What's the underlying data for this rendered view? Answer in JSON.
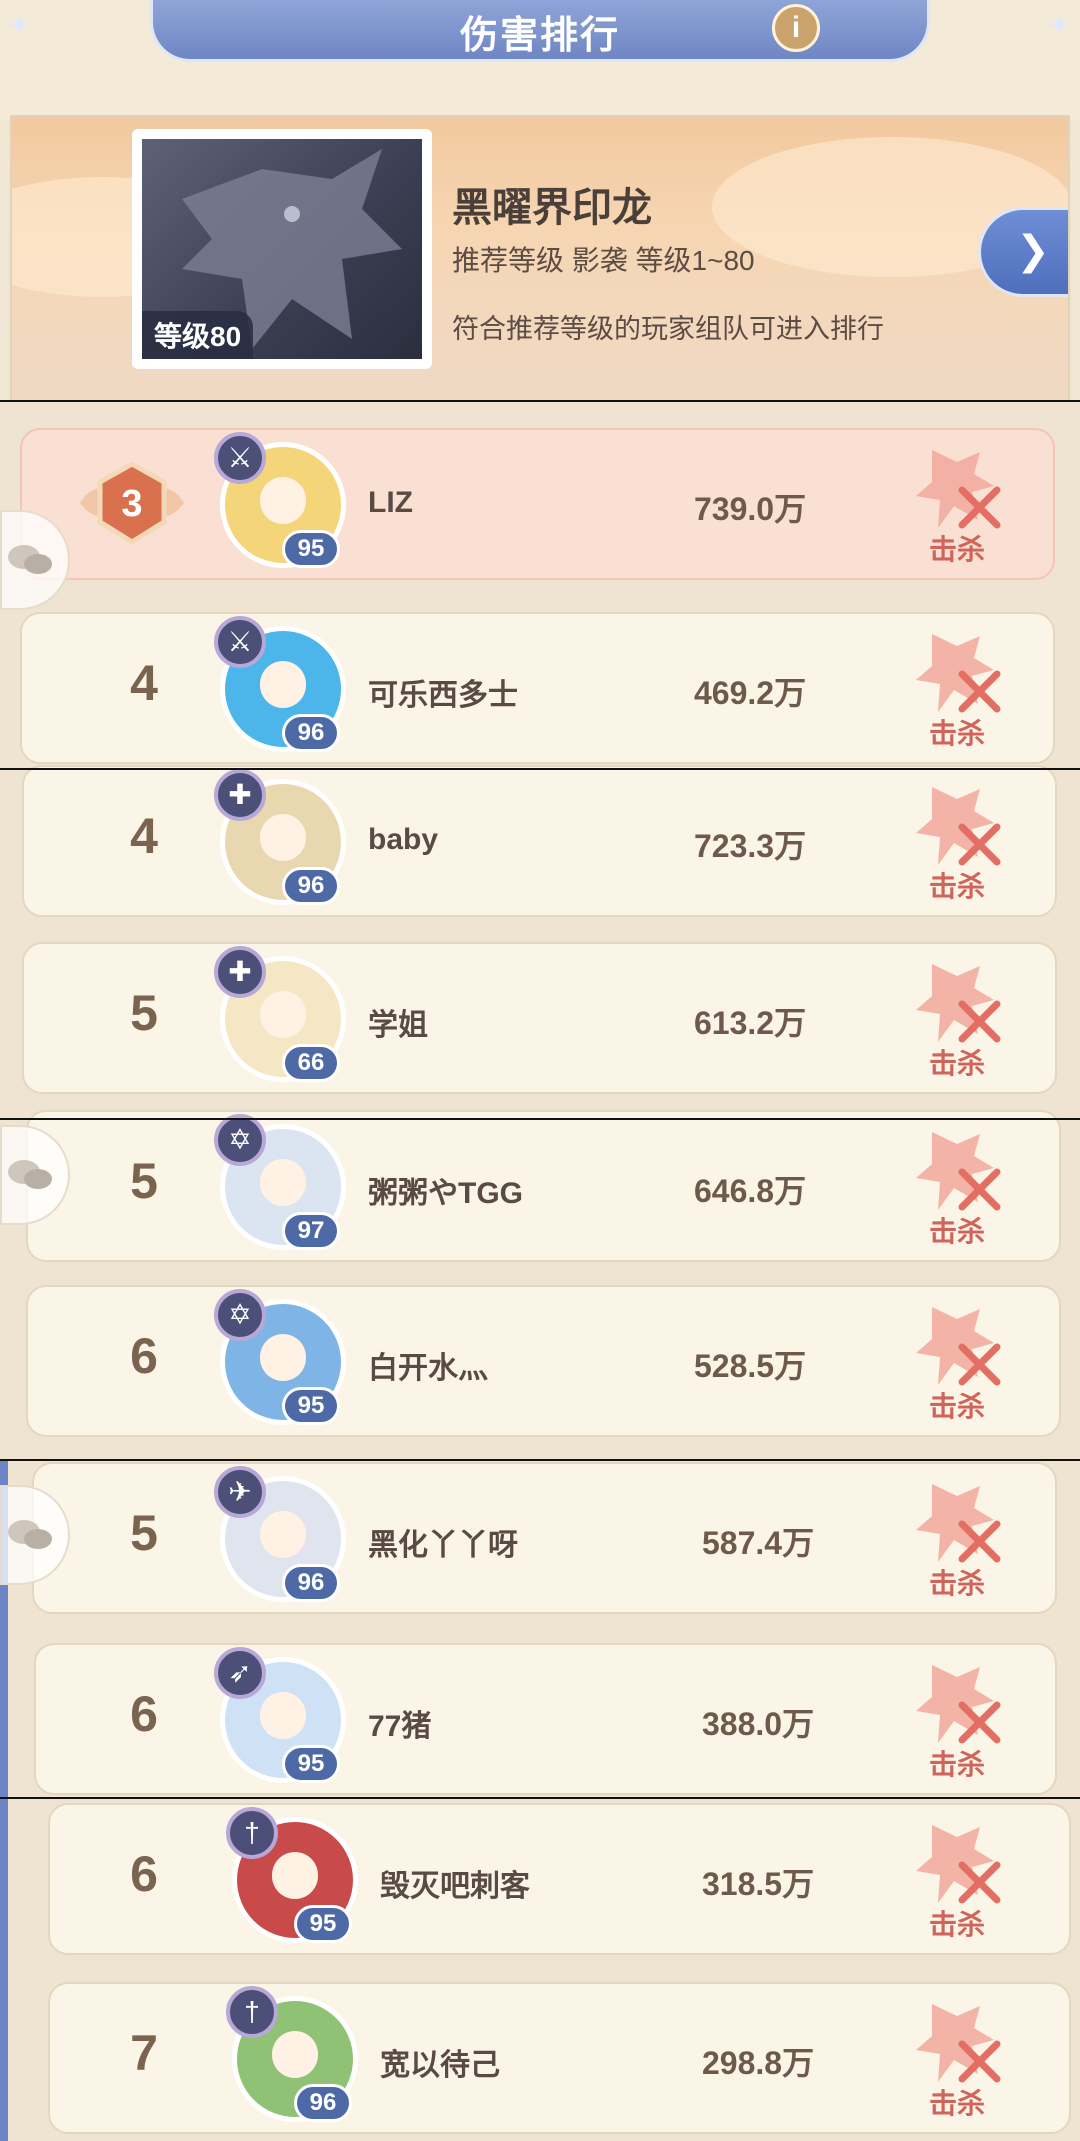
{
  "header": {
    "title": "伤害排行",
    "info_icon": "info-icon"
  },
  "boss": {
    "name": "黑曜界印龙",
    "level_badge": "等级80",
    "recommend": "推荐等级 影袭  等级1~80",
    "note": "符合推荐等级的玩家组队可进入排行",
    "next_icon": "chevron-right-icon"
  },
  "rows": [
    {
      "rank": "3",
      "name": "LIZ",
      "level": "95",
      "damage": "739.0万",
      "kill": "击杀",
      "class_icon": "sword-icon",
      "avatar_color": "#f4d57a"
    },
    {
      "rank": "4",
      "name": "可乐西多士",
      "level": "96",
      "damage": "469.2万",
      "kill": "击杀",
      "class_icon": "sword-icon",
      "avatar_color": "#4cb6ea"
    },
    {
      "rank": "4",
      "name": "baby",
      "level": "96",
      "damage": "723.3万",
      "kill": "击杀",
      "class_icon": "cross-icon",
      "avatar_color": "#e9d7b0"
    },
    {
      "rank": "5",
      "name": "学姐",
      "level": "66",
      "damage": "613.2万",
      "kill": "击杀",
      "class_icon": "cross-icon",
      "avatar_color": "#f6e7c4"
    },
    {
      "rank": "5",
      "name": "粥粥やTGG",
      "level": "97",
      "damage": "646.8万",
      "kill": "击杀",
      "class_icon": "star-icon",
      "avatar_color": "#dbe5f2"
    },
    {
      "rank": "6",
      "name": "白开水灬",
      "level": "95",
      "damage": "528.5万",
      "kill": "击杀",
      "class_icon": "star-icon",
      "avatar_color": "#7fb5e6"
    },
    {
      "rank": "5",
      "name": "黑化丫丫呀",
      "level": "96",
      "damage": "587.4万",
      "kill": "击杀",
      "class_icon": "plane-icon",
      "avatar_color": "#dfe4ef"
    },
    {
      "rank": "6",
      "name": "77猪",
      "level": "95",
      "damage": "388.0万",
      "kill": "击杀",
      "class_icon": "bow-icon",
      "avatar_color": "#cfe2f5"
    },
    {
      "rank": "6",
      "name": "毁灭吧刺客",
      "level": "95",
      "damage": "318.5万",
      "kill": "击杀",
      "class_icon": "dagger-icon",
      "avatar_color": "#c94a4a"
    },
    {
      "rank": "7",
      "name": "宽以待己",
      "level": "96",
      "damage": "298.8万",
      "kill": "击杀",
      "class_icon": "dagger-icon",
      "avatar_color": "#8fc274"
    }
  ]
}
